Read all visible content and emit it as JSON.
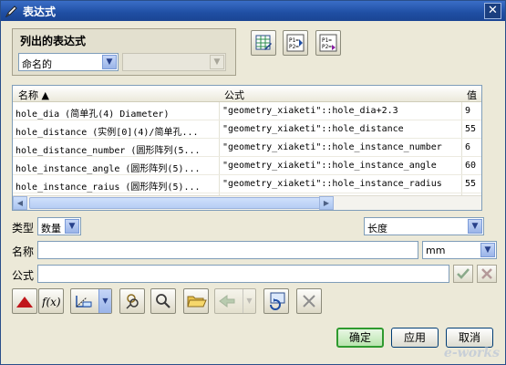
{
  "window": {
    "title": "表达式",
    "close_label": "✕"
  },
  "list_group": {
    "label": "列出的表达式",
    "filter_value": "命名的",
    "secondary_value": ""
  },
  "table": {
    "headers": {
      "name": "名称 ▲",
      "formula": "公式",
      "value": "值"
    },
    "rows": [
      {
        "name": "hole_dia  (简单孔(4) Diameter)",
        "formula": "\"geometry_xiaketi\"::hole_dia+2.3",
        "value": "9"
      },
      {
        "name": "hole_distance  (实例[0](4)/简单孔...",
        "formula": "\"geometry_xiaketi\"::hole_distance",
        "value": "55"
      },
      {
        "name": "hole_distance_number  (圆形阵列(5...",
        "formula": "\"geometry_xiaketi\"::hole_instance_number",
        "value": "6"
      },
      {
        "name": "hole_instance_angle  (圆形阵列(5)...",
        "formula": "\"geometry_xiaketi\"::hole_instance_angle",
        "value": "60"
      },
      {
        "name": "hole_instance_raius  (圆形阵列(5)...",
        "formula": "\"geometry_xiaketi\"::hole_instance_radius",
        "value": "55"
      }
    ]
  },
  "type_row": {
    "label": "类型",
    "type_value": "数量",
    "dimension_value": "长度"
  },
  "name_row": {
    "label": "名称",
    "value": "",
    "unit_value": "mm"
  },
  "formula_row": {
    "label": "公式",
    "value": ""
  },
  "buttons": {
    "ok": "确定",
    "apply": "应用",
    "cancel": "取消"
  },
  "watermark": "e-works",
  "icons": {
    "toolbar_top": [
      "spreadsheet-edit-icon",
      "list-part-expressions-icon",
      "list-all-expressions-icon"
    ],
    "bottom_toolbar": [
      "dimension-triangle-icon",
      "function-icon",
      "measure-icon",
      "reference-icon",
      "interpart-icon",
      "open-folder-icon",
      "replace-icon",
      "refresh-icon",
      "delete-icon"
    ]
  }
}
